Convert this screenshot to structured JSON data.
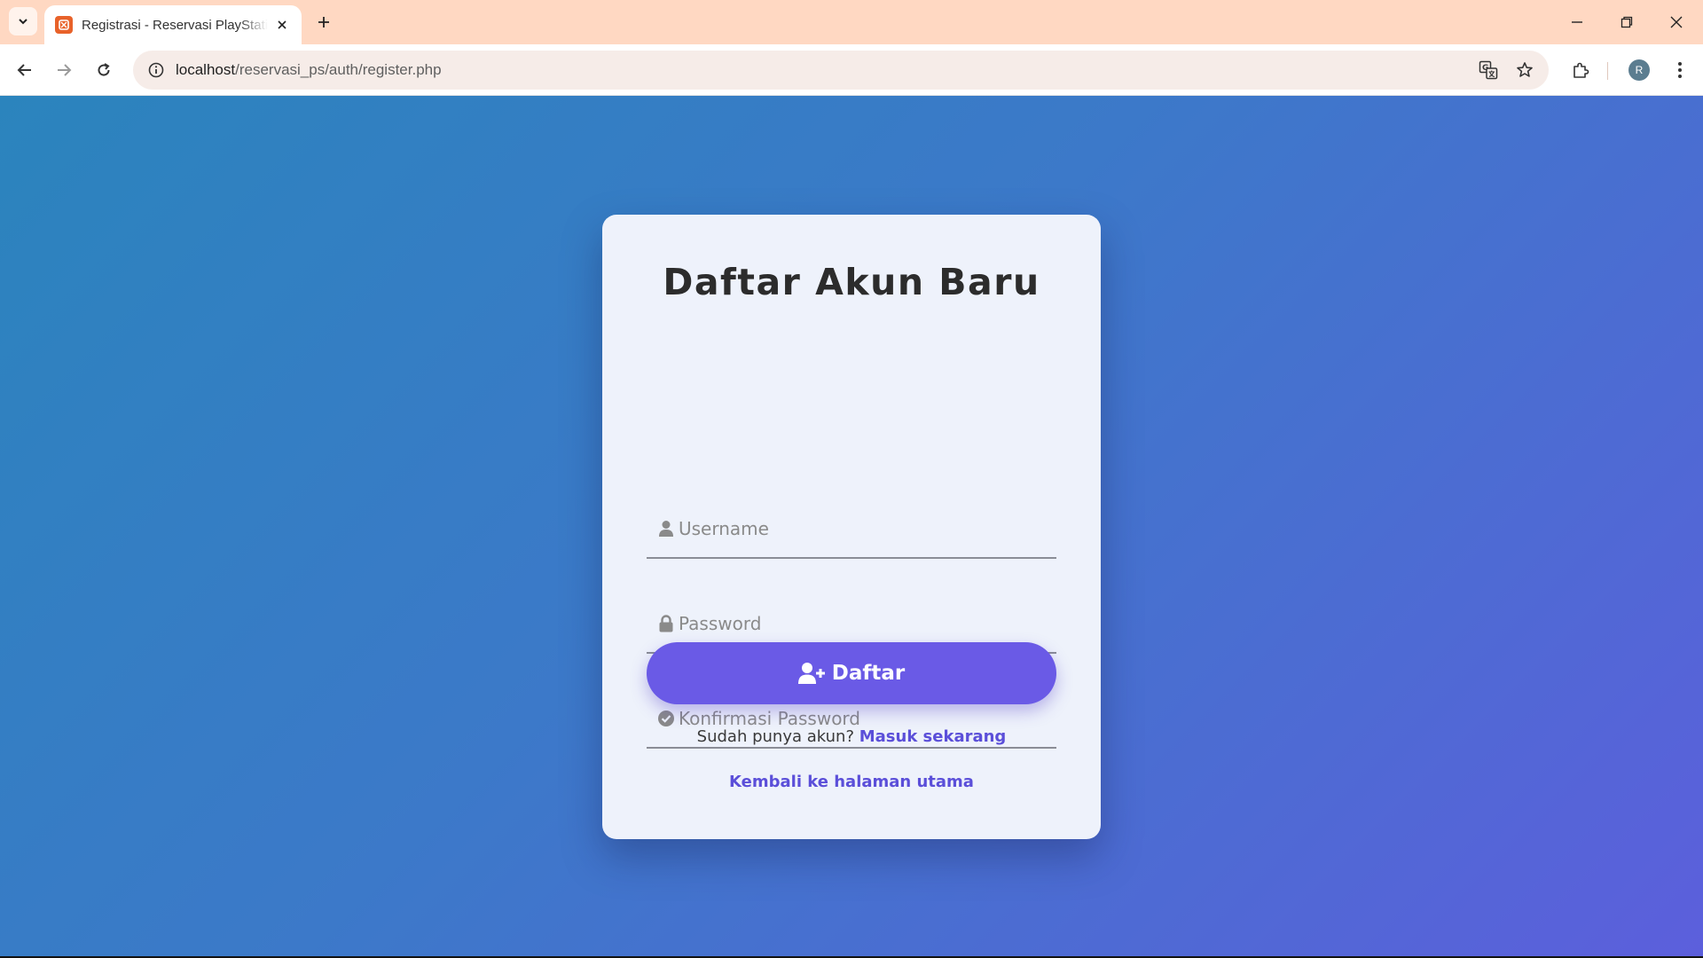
{
  "browser": {
    "tab_title": "Registrasi - Reservasi PlayStation",
    "url_host": "localhost",
    "url_path": "/reservasi_ps/auth/register.php",
    "profile_initial": "R",
    "icons": [
      "tab-search-icon",
      "tab-favicon",
      "close-icon",
      "new-tab-icon",
      "minimize-icon",
      "restore-icon",
      "window-close-icon",
      "back-icon",
      "forward-icon",
      "reload-icon",
      "site-info-icon",
      "translate-icon",
      "bookmark-star-icon",
      "extensions-icon",
      "menu-kebab-icon"
    ]
  },
  "form": {
    "title": "Daftar Akun Baru",
    "username_placeholder": "Username",
    "password_placeholder": "Password",
    "confirm_placeholder": "Konfirmasi Password",
    "submit_label": "Daftar",
    "login_prompt": "Sudah punya akun?",
    "login_link": "Masuk sekarang",
    "home_link": "Kembali ke halaman utama"
  },
  "colors": {
    "accent": "#6a5ae6",
    "link": "#5b4fd9",
    "background_start": "#2b84bd",
    "background_end": "#5c5fdc",
    "tabstrip": "#ffd8c2"
  }
}
